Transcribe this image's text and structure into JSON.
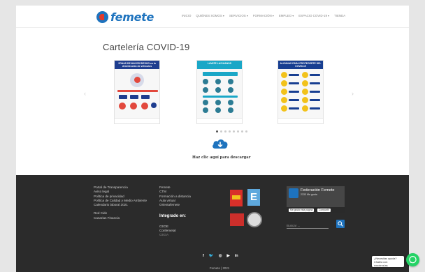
{
  "brand": {
    "logo_text": "femete",
    "accent": "#1e73be",
    "logo_red": "#e03a2c"
  },
  "nav": [
    {
      "label": "INICIO",
      "caret": false
    },
    {
      "label": "QUIÉNES SOMOS",
      "caret": true
    },
    {
      "label": "SERVICIOS",
      "caret": true
    },
    {
      "label": "FORMACIÓN",
      "caret": true
    },
    {
      "label": "EMPLEO",
      "caret": true
    },
    {
      "label": "ESPACIO COVID-19",
      "caret": true
    },
    {
      "label": "TIENDA",
      "caret": false
    }
  ],
  "main": {
    "title": "Cartelería COVID-19",
    "posters": [
      {
        "heading": "ZONAS DE MAYOR RIESGO en la desinfección de vehículos",
        "color": "#1e3d8f"
      },
      {
        "heading": "LAVATE LAS MANOS",
        "color": "#1aa7c7"
      },
      {
        "heading": "ALGUNAS PARA PROTEGERTE DEL COVID-19",
        "color": "#173e91"
      }
    ],
    "pager": {
      "count": 8,
      "active": 0
    },
    "download_icon": "cloud-download-icon",
    "download_text": "Haz clic aquí para descargar"
  },
  "footer": {
    "col1": [
      "Portal de Transparencia",
      "Aviso legal",
      "Política de privacidad",
      "Política de Calidad y Medio Ambiente",
      "Calendario laboral 2021"
    ],
    "col1b": [
      "Red Cide",
      "Canarias Financia"
    ],
    "col2": [
      "Femete",
      "CTM",
      "Formación a distancia",
      "Aula virtual",
      "Orientafemete"
    ],
    "integrado_title": "Integrado en:",
    "col2b": [
      "CEOE",
      "Confemetal",
      "CEGA"
    ],
    "facebook": {
      "name": "Federación Femete",
      "followers": "2333 Me gusta",
      "like_label": "Me gusta esta página",
      "share_label": "Compartir"
    },
    "search_placeholder": "Buscar ...",
    "social_icons": [
      "facebook-icon",
      "twitter-icon",
      "instagram-icon",
      "youtube-icon",
      "linkedin-icon"
    ],
    "copyright": "Femete | 2021"
  },
  "chat": {
    "bubble_text": "¿Necesitas ayuda? Chatea con nosotros/as",
    "color": "#25d366"
  }
}
